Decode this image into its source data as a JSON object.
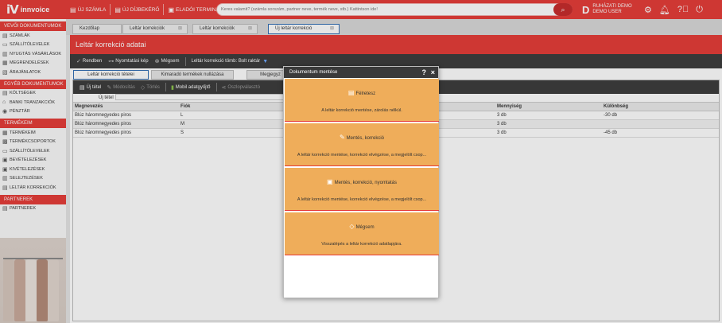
{
  "header": {
    "logo_text": "innvoice",
    "buttons": [
      {
        "label": "ÚJ SZÁMLA",
        "icon": "document-plus-icon"
      },
      {
        "label": "ÚJ DÍJBEKÉRŐ",
        "icon": "document-plus-icon"
      },
      {
        "label": "ELADÓI TERMINÁL",
        "icon": "terminal-icon"
      }
    ],
    "search_placeholder": "Keres valamit? (számla sorszám, partner neve, termék neve, stb.) Kattintson ide!",
    "user_initial": "D",
    "user_company": "RUHÁZATI DEMO",
    "user_name": "DEMO USER"
  },
  "sidebar": {
    "sections": [
      {
        "title": "VEVŐI DOKUMENTUMOK",
        "items": [
          "SZÁMLÁK",
          "SZÁLLÍTÓLEVELEK",
          "NYUGTÁS VÁSÁRLÁSOK",
          "MEGRENDELÉSEK",
          "ÁRAJÁNLATOK"
        ]
      },
      {
        "title": "EGYÉB DOKUMENTUMOK",
        "items": [
          "KÖLTSÉGEK",
          "BANKI TRANZAKCIÓK",
          "PÉNZTÁR"
        ]
      },
      {
        "title": "TERMÉKEIM",
        "items": [
          "TERMÉKEIM",
          "TERMÉKCSOPORTOK",
          "SZÁLLÍTÓLEVELEK",
          "BEVÉTELEZÉSEK",
          "KIVÉTELEZÉSEK",
          "SELEJTEZÉSEK",
          "LELTÁR KORREKCIÓK"
        ]
      },
      {
        "title": "PARTNEREK",
        "items": [
          "PARTNEREK"
        ]
      }
    ]
  },
  "tabs": [
    "Kezdőlap",
    "Leltár korrekciók",
    "Leltár korrekciók",
    "Új leltár korrekció"
  ],
  "panel": {
    "title": "Leltár korrekció adatai",
    "actions": [
      "Rendben",
      "Nyomtatási kép",
      "Mégsem",
      "Leltár korrekció tömb: Bolt raktár"
    ],
    "sub_tabs": [
      "Leltár korrekció tételei",
      "Kimaradó termékek nullázása",
      "Megjegyz"
    ],
    "tools": [
      "Új tétel",
      "Módosítás",
      "Törlés",
      "Mobil adatgyűjtő",
      "Oszlopválasztó"
    ],
    "filter_label": "Új tétel",
    "columns": [
      "Megnevezés",
      "Fiók",
      "Mennyiség",
      "Különbség"
    ],
    "rows": [
      {
        "name": "Blúz háromnegyedes piros",
        "fiok": "L",
        "qty": "3 db",
        "diff": "-30 db"
      },
      {
        "name": "Blúz háromnegyedes piros",
        "fiok": "M",
        "qty": "3 db",
        "diff": ""
      },
      {
        "name": "Blúz háromnegyedes piros",
        "fiok": "S",
        "qty": "3 db",
        "diff": "-45 db"
      }
    ]
  },
  "modal": {
    "title": "Dokumentum mentése",
    "options": [
      {
        "title": "Félretesz",
        "desc": "A leltár korrekció mentése, zárolás nélkül.",
        "icon": "document-icon"
      },
      {
        "title": "Mentés, korrekció",
        "desc": "A leltár korrekció mentése, korrekció elvégzése, a megjelölt csop...",
        "icon": "pencil-icon"
      },
      {
        "title": "Mentés, korrekció, nyomtatás",
        "desc": "A leltár korrekció mentése, korrekció elvégzése, a megjelölt csop...",
        "icon": "printer-icon"
      },
      {
        "title": "Mégsem",
        "desc": "Visszalépés a leltár korrekció adatlapjára.",
        "icon": "eraser-icon"
      }
    ]
  },
  "colors": {
    "brand_red": "#e53935",
    "option_orange": "#efad5a",
    "toolbar_dark": "#3a3a3a",
    "active_tab_border": "#2f6db3"
  }
}
